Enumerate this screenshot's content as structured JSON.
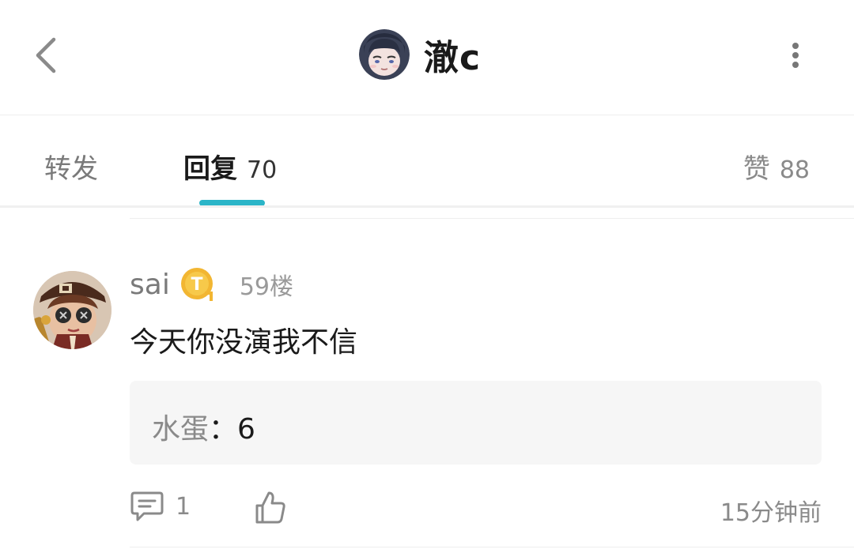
{
  "header": {
    "title": "澈c",
    "back_icon": "chevron-left-icon",
    "more_icon": "more-vertical-icon"
  },
  "tabs": {
    "repost": {
      "label": "转发"
    },
    "reply": {
      "label": "回复",
      "count": "70"
    },
    "like": {
      "label": "赞",
      "count": "88"
    }
  },
  "post": {
    "username": "sai",
    "badge_icon": "member-badge-icon",
    "floor": "59楼",
    "content": "今天你没演我不信",
    "reply": {
      "author": "水蛋",
      "separator": "：",
      "text": "6"
    },
    "comment_count": "1",
    "time": "15分钟前"
  },
  "colors": {
    "accent": "#2bb5c8",
    "badge": "#f2b632"
  }
}
